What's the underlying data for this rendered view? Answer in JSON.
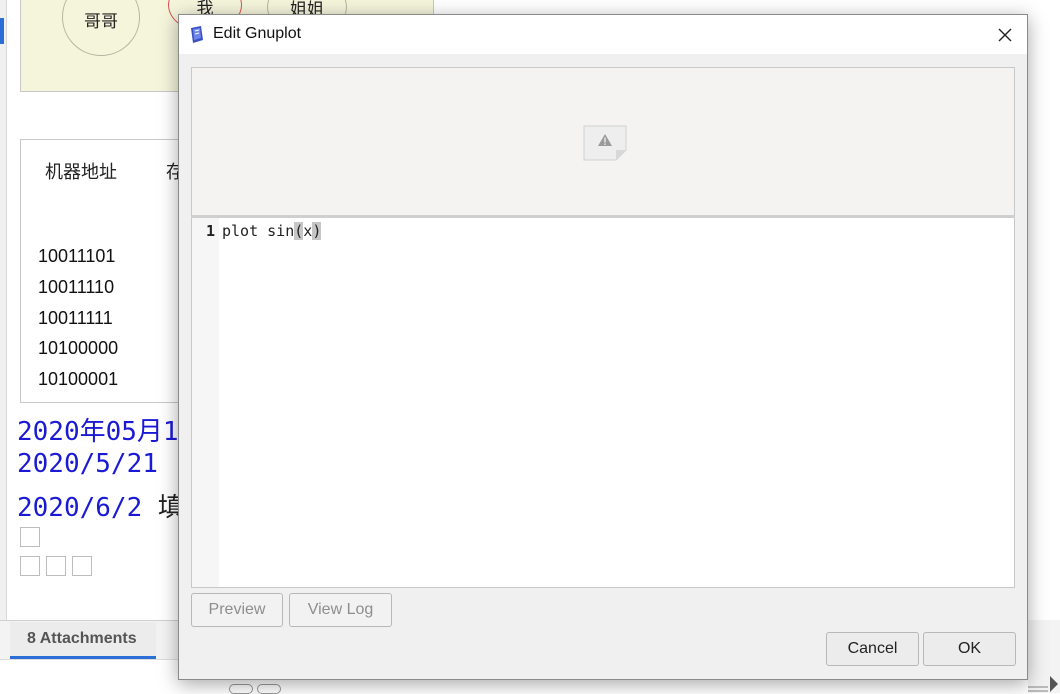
{
  "background": {
    "diagram_nodes": [
      "哥哥",
      "我",
      "姐姐"
    ],
    "table": {
      "headers": [
        "机器地址",
        "存"
      ],
      "addresses": [
        "10011101",
        "10011110",
        "10011111",
        "10100000",
        "10100001"
      ]
    },
    "blue_lines": [
      "2020年05月1",
      "2020/5/21",
      "2020/6/2"
    ],
    "blue_line_tail": "填",
    "attachments_tab": "8 Attachments"
  },
  "dialog": {
    "title": "Edit Gnuplot",
    "preview_status": "broken-image-icon",
    "editor": {
      "line_number": "1",
      "code_before": "plot sin",
      "code_open": "(",
      "code_arg": "x",
      "code_close": ")"
    },
    "buttons": {
      "preview": "Preview",
      "view_log": "View Log",
      "cancel": "Cancel",
      "ok": "OK"
    },
    "colors": {
      "link_blue": "#1a1ad6",
      "tab_accent": "#2b6fd6"
    }
  }
}
